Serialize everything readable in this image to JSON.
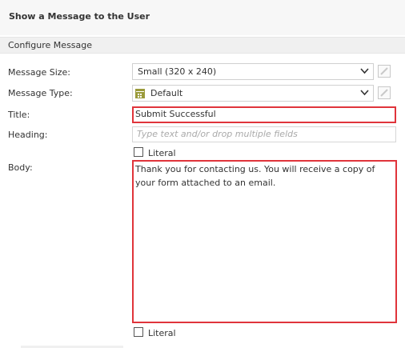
{
  "dialog": {
    "title": "Show a Message to the User"
  },
  "section": {
    "title": "Configure Message"
  },
  "fields": {
    "message_size": {
      "label": "Message Size:",
      "value": "Small (320 x 240)"
    },
    "message_type": {
      "label": "Message Type:",
      "value": "Default",
      "icon": "calendar-grid-icon"
    },
    "title": {
      "label": "Title:",
      "value": "Submit Successful"
    },
    "heading": {
      "label": "Heading:",
      "placeholder": "Type text and/or drop multiple fields",
      "literal_label": "Literal"
    },
    "body": {
      "label": "Body:",
      "value": "Thank you for contacting us. You will receive a copy of your form attached to an email.",
      "literal_label": "Literal"
    }
  },
  "colors": {
    "highlight_border": "#e0343b",
    "header_bg": "#f7f7f7",
    "section_bg": "#f0f0f0",
    "type_icon": "#9a9a3a"
  }
}
